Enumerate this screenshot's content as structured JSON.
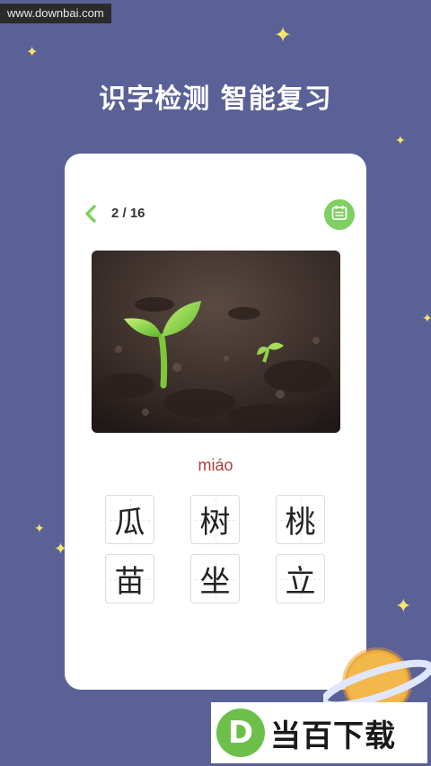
{
  "watermark": {
    "text": "www.downbai.com"
  },
  "headline": "识字检测  智能复习",
  "card": {
    "counter": "2 / 16",
    "pinyin": "miáo",
    "image_alt": "seedling sprouting from soil",
    "characters": [
      "瓜",
      "树",
      "桃",
      "苗",
      "坐",
      "立"
    ]
  },
  "logo": {
    "mark": "D",
    "text": "当百下载"
  },
  "colors": {
    "background": "#5a6197",
    "accent_green": "#7fcf61",
    "pinyin_red": "#b33b3b",
    "star_yellow": "#f6e46e"
  },
  "icons": [
    "back-chevron-icon",
    "calendar-icon",
    "star-icon"
  ]
}
